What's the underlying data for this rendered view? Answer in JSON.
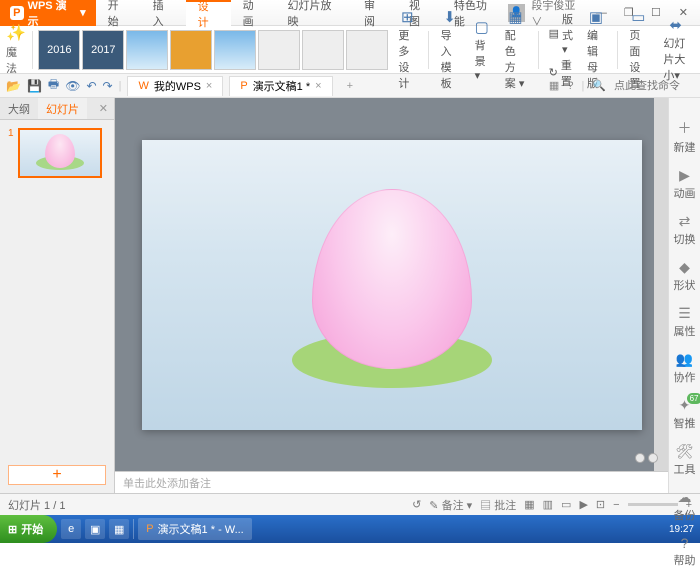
{
  "app": {
    "name": "WPS 演示",
    "dropdown": "▾"
  },
  "user": {
    "name": "段宇俊亚∨"
  },
  "winbtns": {
    "min": "—",
    "layer": "❐",
    "max": "☐",
    "close": "✕"
  },
  "tabs": {
    "home": "开始",
    "insert": "插入",
    "design": "设计",
    "animation": "动画",
    "slideshow": "幻灯片放映",
    "review": "审阅",
    "view": "视图",
    "special": "特色功能"
  },
  "ribbon": {
    "magic": "魔法",
    "more_designs": "更多设计",
    "import_template": "导入模板",
    "background": "背景 ▾",
    "color_scheme": "配色方案 ▾",
    "layout": "版式 ▾",
    "reset": "重置",
    "edit_master": "编辑母版",
    "page_setup": "页面设置",
    "slide_size": "幻灯片大小▾",
    "theme_labels": {
      "t1": "2016",
      "t2": "2017"
    }
  },
  "docbar": {
    "mywps": "我的WPS",
    "doc": "演示文稿1 *",
    "add": "+",
    "search_placeholder": "点此查找命令",
    "icons": {
      "grid": "▦",
      "help": "?",
      "search": "🔍"
    }
  },
  "leftpanel": {
    "outline": "大纲",
    "slides": "幻灯片",
    "close": "✕",
    "slidenum": "1",
    "add": "+"
  },
  "notes": {
    "placeholder": "单击此处添加备注"
  },
  "rightpanel": {
    "new": "新建",
    "anim": "动画",
    "switch": "切换",
    "shape": "形状",
    "attr": "属性",
    "collab": "协作",
    "smart": "智推",
    "tools": "工具",
    "backup": "备份",
    "help": "帮助"
  },
  "status": {
    "slide_count": "幻灯片 1 / 1",
    "history": "↺",
    "notes_btn": "备注 ▾",
    "comment": "批注",
    "viewbtns": {
      "normal": "▦",
      "sorter": "▥",
      "read": "▭",
      "show": "▶"
    },
    "zoom": {
      "out": "−",
      "in": "+",
      "pct": "⊡"
    }
  },
  "taskbar": {
    "start": "开始",
    "app1": "演示文稿1 * - W...",
    "time": "19:27"
  }
}
